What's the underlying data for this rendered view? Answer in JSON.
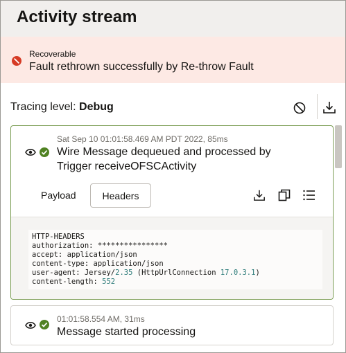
{
  "header": {
    "title": "Activity stream"
  },
  "banner": {
    "label": "Recoverable",
    "message": "Fault rethrown successfully by Re-throw Fault",
    "color": "#d63b25"
  },
  "tracing": {
    "label": "Tracing level:",
    "value": "Debug"
  },
  "activities": [
    {
      "timestamp": "Sat Sep 10 01:01:58.469 AM PDT 2022, 85ms",
      "title_line1": "Wire Message dequeued and processed by",
      "title_line2": "Trigger receiveOFSCActivity",
      "tabs": {
        "payload": "Payload",
        "headers": "Headers"
      },
      "code": {
        "heading": "HTTP-HEADERS",
        "lines": [
          {
            "key": "authorization: ",
            "value": "****************"
          },
          {
            "key": "accept: ",
            "value": "application/json"
          },
          {
            "key": "content-type: ",
            "value": "application/json"
          },
          {
            "key": "user-agent: ",
            "value_a": "Jersey/",
            "num_a": "2.35",
            "value_b": " (HttpUrlConnection ",
            "num_b": "17.0.3.1",
            "value_c": ")"
          },
          {
            "key": "content-length: ",
            "num": "552"
          }
        ]
      }
    },
    {
      "timestamp": "01:01:58.554 AM, 31ms",
      "title_line1": "Message started processing"
    }
  ],
  "colors": {
    "success": "#508223",
    "accent_border": "#7b9d54"
  }
}
